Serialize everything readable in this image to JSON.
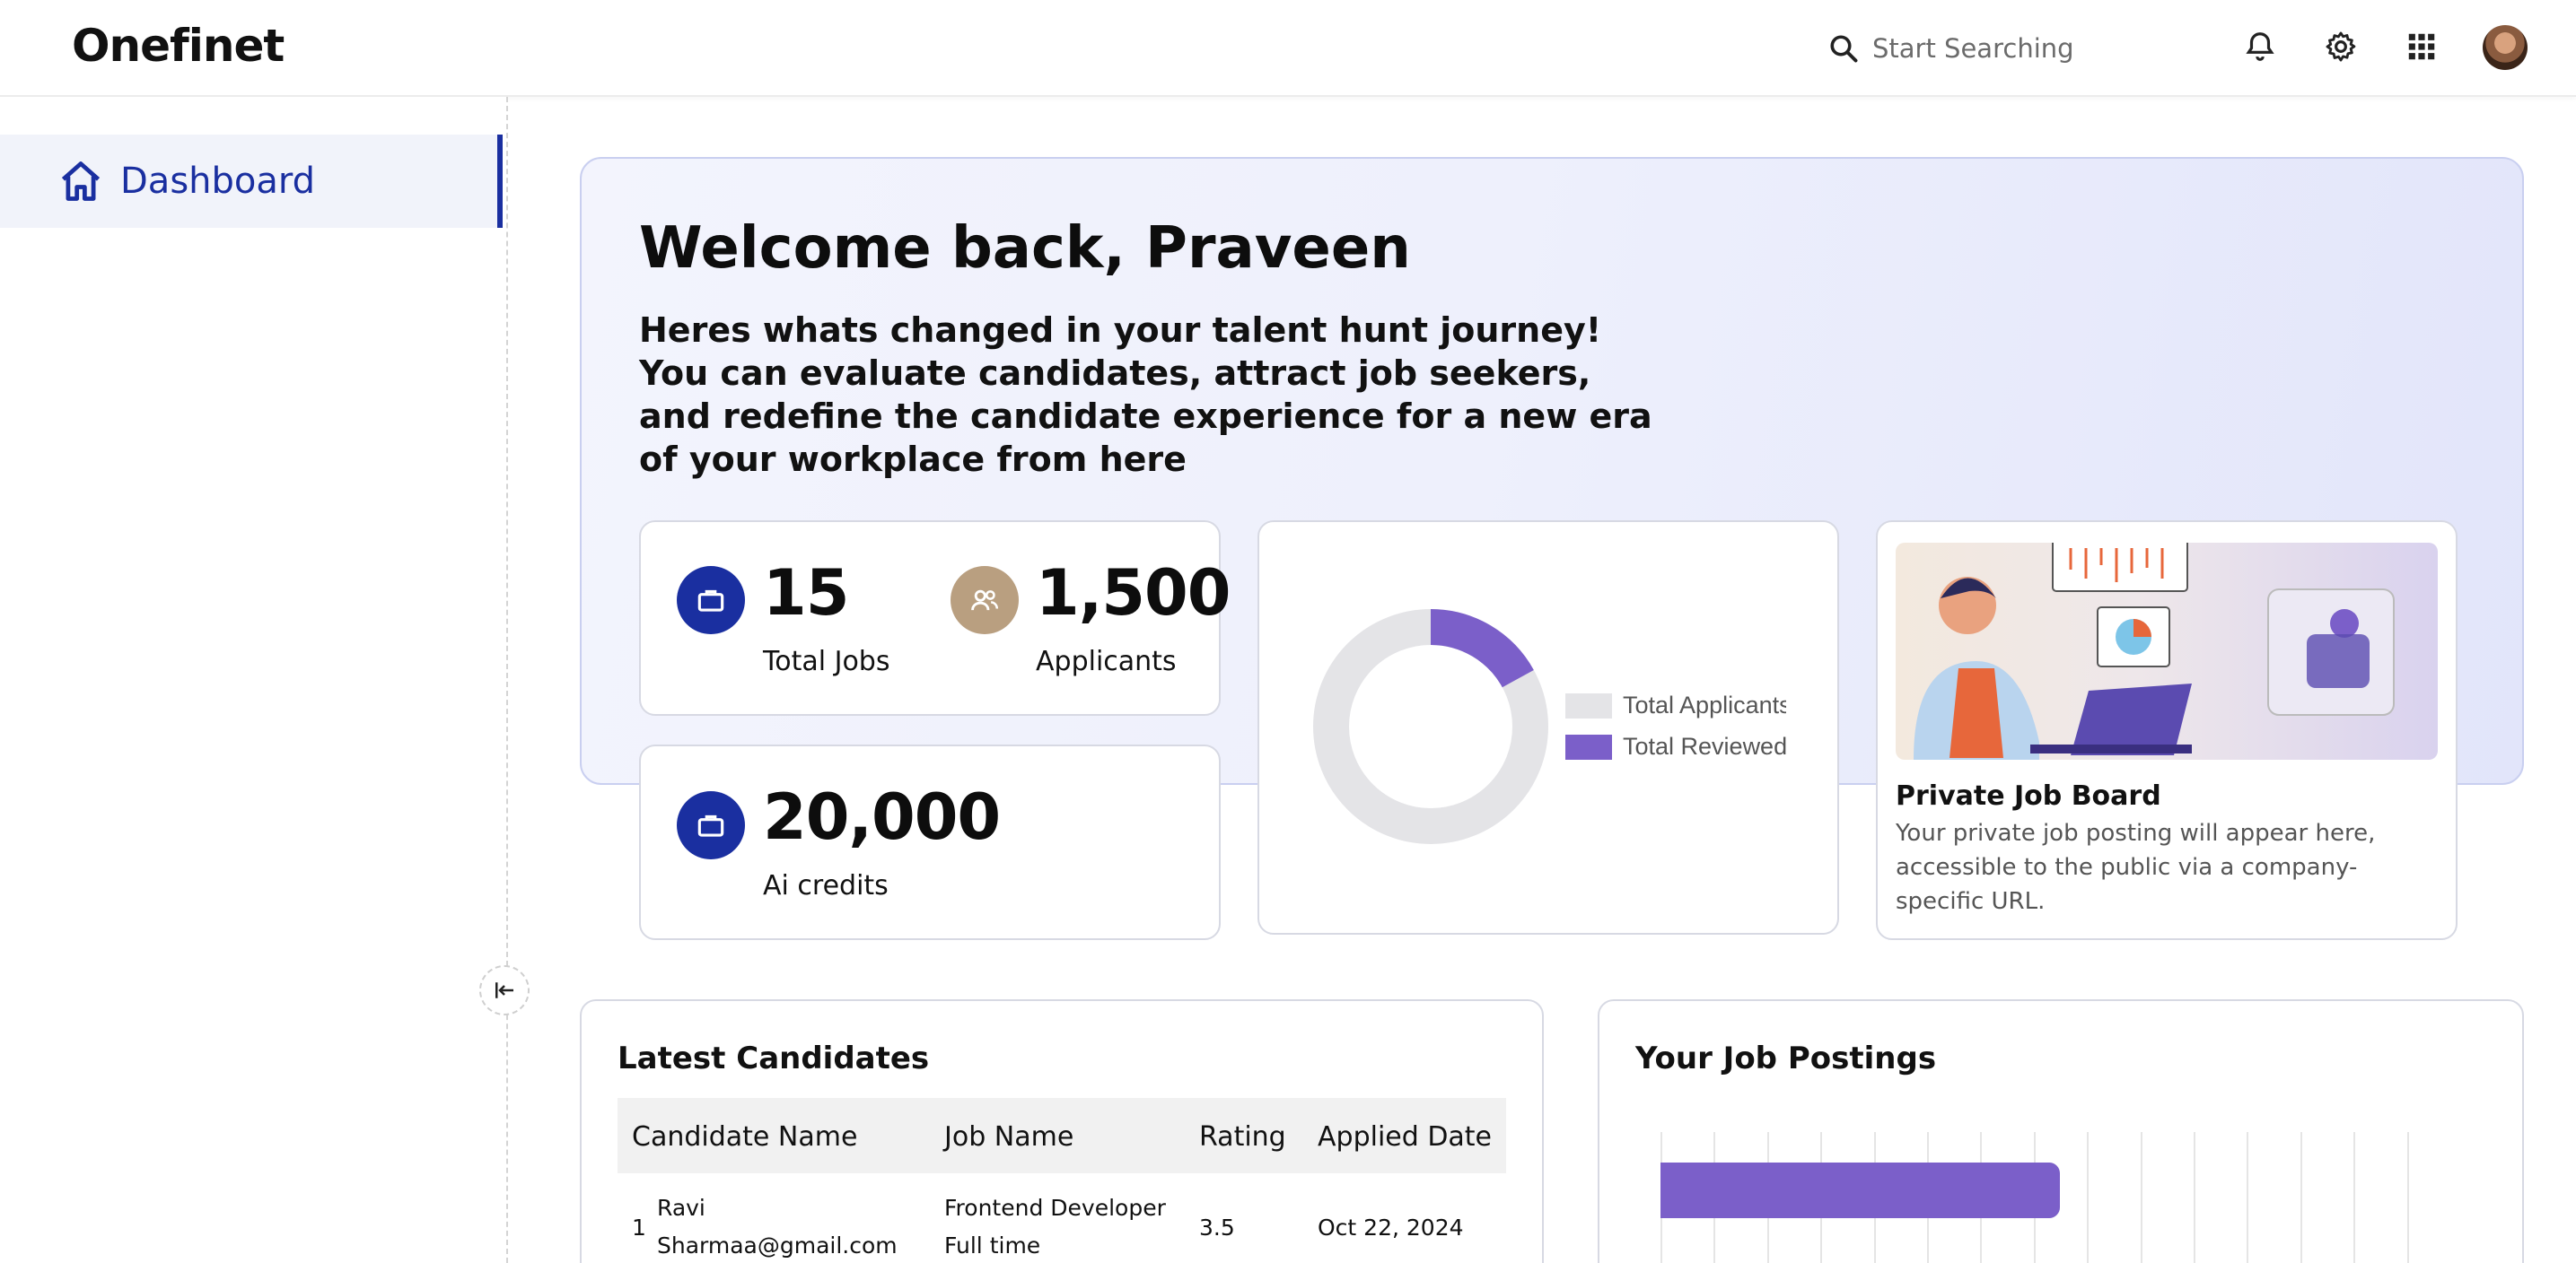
{
  "app": {
    "brand": "Onefinet"
  },
  "header": {
    "search_placeholder": "Start Searching",
    "icons": [
      "search-icon",
      "bell-icon",
      "gear-icon",
      "apps-grid-icon",
      "avatar"
    ]
  },
  "sidebar": {
    "items": [
      {
        "label": "Dashboard",
        "icon": "home-icon",
        "active": true
      }
    ]
  },
  "hero": {
    "title": "Welcome back, Praveen",
    "subtitle": "Heres whats changed in your talent hunt journey! You can evaluate candidates, attract job seekers, and redefine the candidate experience for a new era of your workplace from here"
  },
  "stats": {
    "total_jobs": {
      "value": "15",
      "label": "Total Jobs"
    },
    "applicants": {
      "value": "1,500",
      "label": "Applicants"
    },
    "ai_credits": {
      "value": "20,000",
      "label": "Ai credits"
    }
  },
  "donut": {
    "legend": [
      {
        "label": "Total Applicants",
        "color": "#e4e4e7"
      },
      {
        "label": "Total Reviewed",
        "color": "#7b5fc9"
      }
    ],
    "reviewed_fraction": 0.17
  },
  "job_board": {
    "title": "Private Job Board",
    "description": "Your private job posting will appear here, accessible to the public via a company-specific URL."
  },
  "latest_candidates": {
    "title": "Latest Candidates",
    "columns": [
      "Candidate Name",
      "Job Name",
      "Rating",
      "Applied Date"
    ],
    "rows": [
      {
        "index": "1",
        "name": "Ravi",
        "email": "Sharmaa@gmail.com",
        "job": "Frontend Developer",
        "job_type": "Full time",
        "rating": "3.5",
        "date": "Oct 22, 2024"
      }
    ]
  },
  "job_postings": {
    "title": "Your Job Postings",
    "bar_fraction": 0.38
  },
  "colors": {
    "primary": "#1a2fa0",
    "accent": "#7b5fc9",
    "tan": "#b99f80"
  }
}
